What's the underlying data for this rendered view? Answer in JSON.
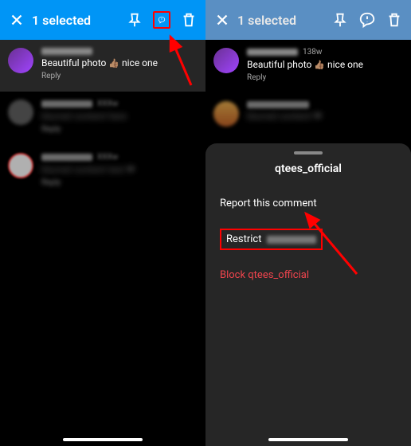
{
  "left": {
    "title": "1 selected",
    "comment1": {
      "text_pre": "Beautiful photo ",
      "text_post": " nice one",
      "reply": "Reply"
    }
  },
  "right": {
    "title": "1 selected",
    "timestamp": "138w",
    "comment1": {
      "text_pre": "Beautiful photo ",
      "text_post": " nice one",
      "reply": "Reply"
    },
    "sheet": {
      "title": "qtees_official",
      "report": "Report this comment",
      "restrict": "Restrict",
      "block": "Block qtees_official"
    }
  }
}
